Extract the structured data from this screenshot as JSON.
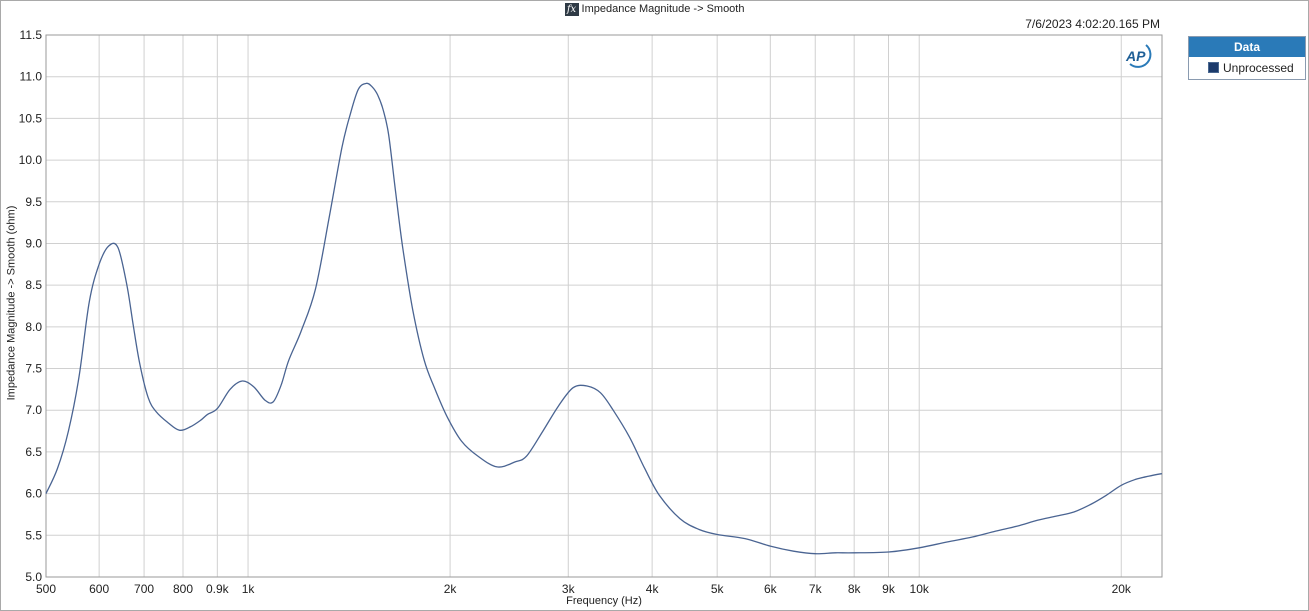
{
  "header": {
    "fx_label": "fx",
    "title": "Impedance Magnitude -> Smooth",
    "timestamp": "7/6/2023 4:02:20.165 PM",
    "logo_text": "AP"
  },
  "legend": {
    "title": "Data",
    "items": [
      {
        "label": "Unprocessed",
        "color": "#1b3a6b"
      }
    ]
  },
  "colors": {
    "line": "#4a6492",
    "grid": "#d0d0d0",
    "legend_header": "#2a7ab8"
  },
  "chart_data": {
    "type": "line",
    "title": "Impedance Magnitude -> Smooth",
    "xlabel": "Frequency (Hz)",
    "ylabel": "Impedance Magnitude -> Smooth (ohm)",
    "xscale": "log",
    "xlim": [
      500,
      23000
    ],
    "ylim": [
      5.0,
      11.5
    ],
    "grid": true,
    "legend_position": "outside-right",
    "xticks": [
      {
        "value": 500,
        "label": "500"
      },
      {
        "value": 600,
        "label": "600"
      },
      {
        "value": 700,
        "label": "700"
      },
      {
        "value": 800,
        "label": "800"
      },
      {
        "value": 900,
        "label": "0.9k"
      },
      {
        "value": 1000,
        "label": "1k"
      },
      {
        "value": 2000,
        "label": "2k"
      },
      {
        "value": 3000,
        "label": "3k"
      },
      {
        "value": 4000,
        "label": "4k"
      },
      {
        "value": 5000,
        "label": "5k"
      },
      {
        "value": 6000,
        "label": "6k"
      },
      {
        "value": 7000,
        "label": "7k"
      },
      {
        "value": 8000,
        "label": "8k"
      },
      {
        "value": 9000,
        "label": "9k"
      },
      {
        "value": 10000,
        "label": "10k"
      },
      {
        "value": 20000,
        "label": "20k"
      }
    ],
    "yticks": [
      {
        "value": 5.0,
        "label": "5.0"
      },
      {
        "value": 5.5,
        "label": "5.5"
      },
      {
        "value": 6.0,
        "label": "6.0"
      },
      {
        "value": 6.5,
        "label": "6.5"
      },
      {
        "value": 7.0,
        "label": "7.0"
      },
      {
        "value": 7.5,
        "label": "7.5"
      },
      {
        "value": 8.0,
        "label": "8.0"
      },
      {
        "value": 8.5,
        "label": "8.5"
      },
      {
        "value": 9.0,
        "label": "9.0"
      },
      {
        "value": 9.5,
        "label": "9.5"
      },
      {
        "value": 10.0,
        "label": "10.0"
      },
      {
        "value": 10.5,
        "label": "10.5"
      },
      {
        "value": 11.0,
        "label": "11.0"
      },
      {
        "value": 11.5,
        "label": "11.5"
      }
    ],
    "minor_x": [
      25000
    ],
    "series": [
      {
        "name": "Unprocessed",
        "x": [
          500,
          520,
          540,
          560,
          580,
          600,
          620,
          640,
          660,
          675,
          690,
          710,
          730,
          760,
          790,
          820,
          850,
          870,
          900,
          940,
          980,
          1020,
          1060,
          1090,
          1120,
          1150,
          1200,
          1260,
          1320,
          1380,
          1420,
          1460,
          1500,
          1530,
          1560,
          1590,
          1620,
          1660,
          1700,
          1760,
          1830,
          1900,
          1980,
          2080,
          2200,
          2350,
          2500,
          2600,
          2750,
          2900,
          3050,
          3200,
          3350,
          3500,
          3700,
          3900,
          4100,
          4400,
          4700,
          5000,
          5500,
          6000,
          6500,
          7000,
          7500,
          8000,
          9000,
          10000,
          11000,
          12000,
          13000,
          14000,
          15000,
          16000,
          17000,
          18000,
          19000,
          20000,
          21000,
          22000,
          23000
        ],
        "y": [
          6.0,
          6.3,
          6.75,
          7.4,
          8.3,
          8.75,
          8.97,
          8.95,
          8.5,
          8.0,
          7.55,
          7.15,
          6.98,
          6.85,
          6.76,
          6.8,
          6.88,
          6.95,
          7.02,
          7.25,
          7.35,
          7.28,
          7.12,
          7.1,
          7.3,
          7.6,
          7.95,
          8.45,
          9.3,
          10.15,
          10.55,
          10.85,
          10.92,
          10.88,
          10.78,
          10.6,
          10.3,
          9.6,
          8.95,
          8.2,
          7.6,
          7.25,
          6.92,
          6.63,
          6.45,
          6.32,
          6.38,
          6.45,
          6.75,
          7.05,
          7.27,
          7.29,
          7.21,
          7.0,
          6.68,
          6.3,
          5.98,
          5.7,
          5.57,
          5.51,
          5.46,
          5.37,
          5.31,
          5.28,
          5.29,
          5.29,
          5.3,
          5.35,
          5.42,
          5.48,
          5.55,
          5.61,
          5.68,
          5.73,
          5.78,
          5.87,
          5.98,
          6.1,
          6.17,
          6.21,
          6.24
        ]
      }
    ]
  }
}
